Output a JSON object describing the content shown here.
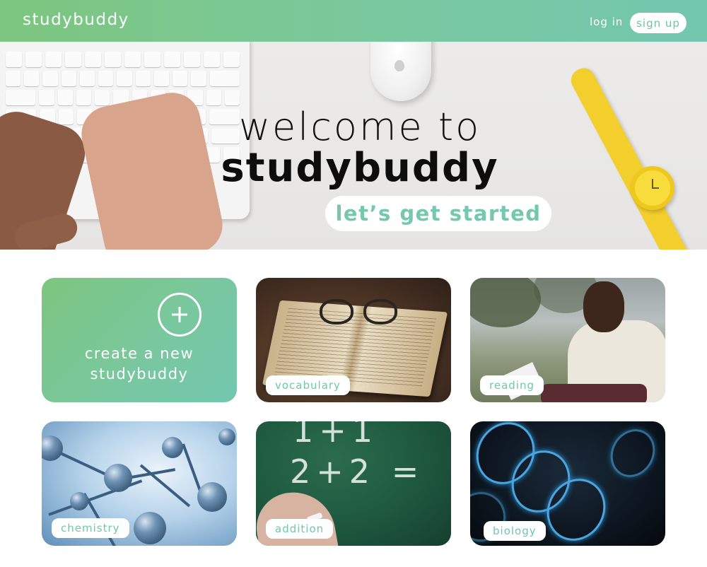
{
  "header": {
    "logo": "studybuddy",
    "login_label": "log in",
    "signup_label": "sign up"
  },
  "hero": {
    "line1": "welcome to",
    "line2": "studybuddy",
    "cta_label": "let’s get started"
  },
  "cards": {
    "create": {
      "line1": "create a new",
      "line2": "studybuddy"
    },
    "vocabulary": {
      "label": "vocabulary"
    },
    "reading": {
      "label": "reading"
    },
    "chemistry": {
      "label": "chemistry"
    },
    "addition": {
      "label": "addition",
      "chalk1": "1+1",
      "chalk2": "2+2 ="
    },
    "biology": {
      "label": "biology"
    }
  },
  "colors": {
    "brand_green": "#7cc67f",
    "brand_teal": "#73c7ae",
    "white": "#ffffff"
  }
}
